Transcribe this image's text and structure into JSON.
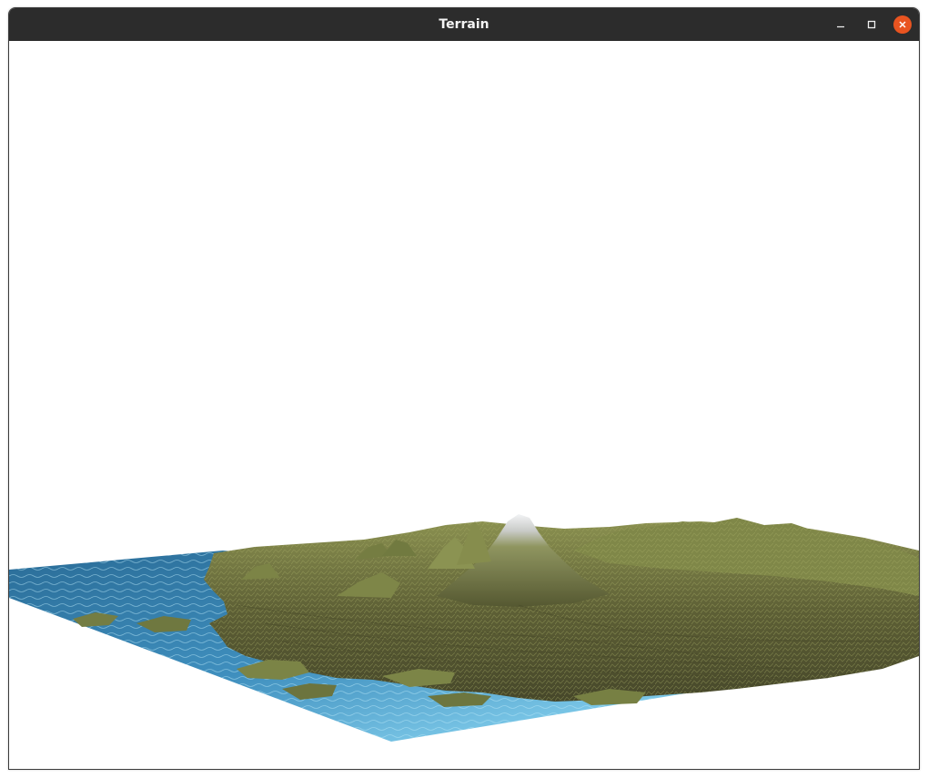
{
  "window": {
    "title": "Terrain",
    "controls": {
      "minimize_icon": "minimize-icon",
      "maximize_icon": "maximize-icon",
      "close_icon": "close-icon"
    },
    "colors": {
      "titlebar": "#2c2c2c",
      "close_button": "#e95420",
      "background": "#ffffff"
    }
  },
  "scene": {
    "colors": {
      "water_deep": "#1e5a86",
      "water_light": "#8fd3f0",
      "land_dark": "#4a4a2a",
      "land_light": "#9aa05a",
      "snow": "#e9ecef"
    }
  }
}
